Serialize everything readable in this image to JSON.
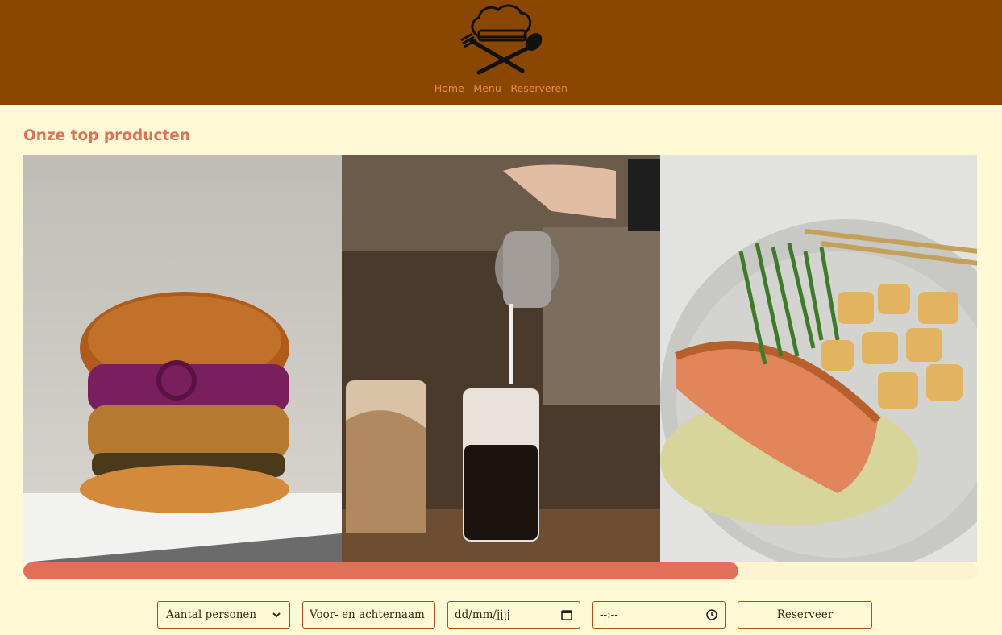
{
  "header": {
    "logo_alt": "Chef hat with crossed fork and spoon logo",
    "nav": [
      "Home",
      "Menu",
      "Reserveren"
    ]
  },
  "main": {
    "section_title": "Onze top producten",
    "gallery": [
      {
        "name": "burger-photo"
      },
      {
        "name": "iced-coffee-photo"
      },
      {
        "name": "salmon-photo"
      }
    ],
    "scroll_progress": 0.75
  },
  "reservation": {
    "persons_placeholder": "Aantal personen",
    "name_placeholder": "Voor- en achternaam",
    "date_placeholder": "dd/mm/jjjj",
    "time_placeholder": "--:--",
    "submit_label": "Reserveer"
  },
  "colors": {
    "header_bg": "#8a4701",
    "page_bg": "#fff9d6",
    "accent": "#e07158",
    "nav_link": "#e98a4f"
  }
}
